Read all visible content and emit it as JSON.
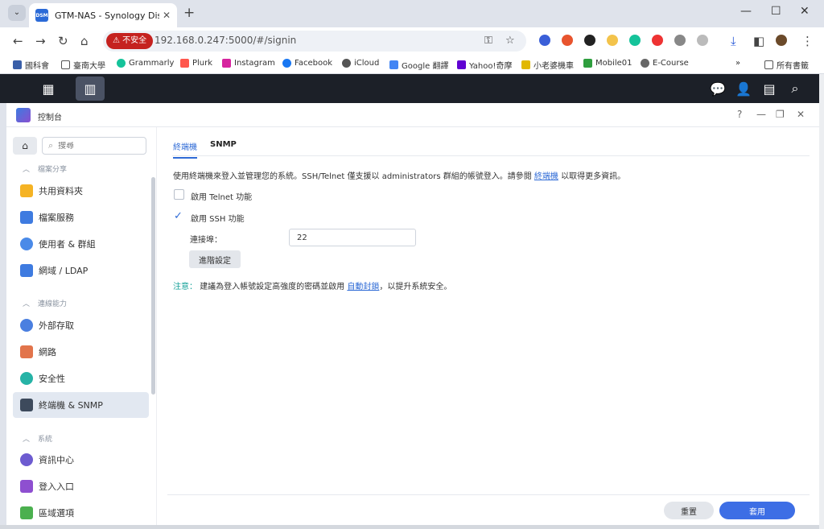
{
  "browser": {
    "tab_title": "GTM-NAS - Synology DiskSta",
    "favicon_text": "DSM",
    "url": "192.168.0.247:5000/#/signin",
    "insecure_label": "不安全"
  },
  "bookmarks": [
    {
      "label": "國科會",
      "color": "#3a5fa8"
    },
    {
      "label": "臺南大學",
      "color": "#555555"
    },
    {
      "label": "Grammarly",
      "color": "#15c39a"
    },
    {
      "label": "Plurk",
      "color": "#ff574d"
    },
    {
      "label": "Instagram",
      "color": "#d6249f"
    },
    {
      "label": "Facebook",
      "color": "#1877f2"
    },
    {
      "label": "iCloud",
      "color": "#555555"
    },
    {
      "label": "Google 翻譯",
      "color": "#4285f4"
    },
    {
      "label": "Yahoo!奇摩",
      "color": "#6001d2"
    },
    {
      "label": "小老婆機車",
      "color": "#e1b800"
    },
    {
      "label": "Mobile01",
      "color": "#2e9e3e"
    },
    {
      "label": "E-Course",
      "color": "#666666"
    }
  ],
  "bookmarks_more": "»",
  "bookmarks_all": "所有書籤",
  "window": {
    "title": "控制台",
    "help": "?"
  },
  "sidebar": {
    "search_placeholder": "搜尋",
    "sections": [
      {
        "label": "檔案分享"
      },
      {
        "label": "連線能力"
      },
      {
        "label": "系統"
      }
    ],
    "items": [
      {
        "label": "共用資料夾",
        "color": "#f5b324"
      },
      {
        "label": "檔案服務",
        "color": "#3e7be0"
      },
      {
        "label": "使用者 & 群組",
        "color": "#4a8ae8"
      },
      {
        "label": "網域 / LDAP",
        "color": "#3e7be0"
      },
      {
        "label": "外部存取",
        "color": "#4a7fe0"
      },
      {
        "label": "網路",
        "color": "#e2744b"
      },
      {
        "label": "安全性",
        "color": "#26b3a6"
      },
      {
        "label": "終端機 & SNMP",
        "color": "#3d4a5c"
      },
      {
        "label": "資訊中心",
        "color": "#6d5bd0"
      },
      {
        "label": "登入入口",
        "color": "#8e4fd0"
      },
      {
        "label": "區域選項",
        "color": "#4bb04f"
      }
    ]
  },
  "content": {
    "tabs": [
      {
        "label": "終端機"
      },
      {
        "label": "SNMP"
      }
    ],
    "description": "使用終端機來登入並管理您的系統。SSH/Telnet 僅支援以 administrators 群組的帳號登入。請參閱",
    "description_link": "終端機",
    "description_tail": "以取得更多資訊。",
    "telnet_label": "啟用 Telnet 功能",
    "ssh_label": "啟用 SSH 功能",
    "port_label": "連接埠：",
    "port_value": "22",
    "advanced_button": "進階設定",
    "note_prefix": "注意：",
    "note_text": "建議為登入帳號設定高強度的密碼並啟用",
    "note_link": "自動封鎖",
    "note_tail": "，以提升系統安全。"
  },
  "footer": {
    "reset": "重置",
    "apply": "套用"
  }
}
